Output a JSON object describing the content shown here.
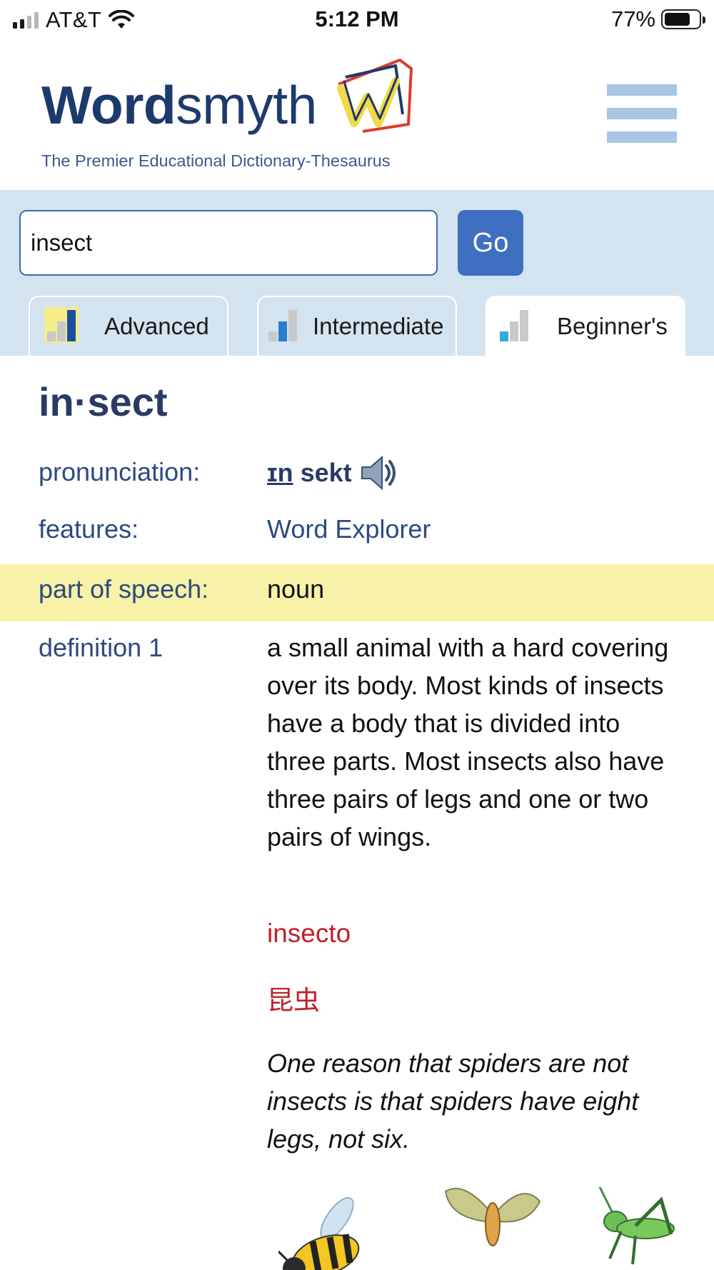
{
  "status_bar": {
    "carrier": "AT&T",
    "time": "5:12 PM",
    "battery_percent": "77%",
    "battery_level": 0.77
  },
  "header": {
    "logo_bold": "Word",
    "logo_light": "smyth",
    "tagline": "The Premier Educational Dictionary-Thesaurus",
    "menu_icon": "hamburger-menu-icon",
    "colors": {
      "logo_blue": "#1d3a6c",
      "menu": "#a8c5e2"
    }
  },
  "search": {
    "value": "insect",
    "go_label": "Go",
    "colors": {
      "band": "#d4e3f0",
      "button": "#3f6fc0"
    }
  },
  "tabs": [
    {
      "label": "Advanced",
      "icon": "level-advanced-icon",
      "active": false
    },
    {
      "label": "Intermediate",
      "icon": "level-intermediate-icon",
      "active": false
    },
    {
      "label": "Beginner's",
      "icon": "level-beginner-icon",
      "active": true
    }
  ],
  "entry": {
    "headword": "in·sect",
    "pronunciation_label": "pronunciation:",
    "pronunciation_stressed": "ɪn",
    "pronunciation_rest": "sekt",
    "audio_icon": "speaker-icon",
    "features_label": "features:",
    "features_value": "Word Explorer",
    "pos_label": "part of speech:",
    "pos_value": "noun",
    "definition_label": "definition 1",
    "definition_text": "a small animal with a hard covering over its body. Most kinds of insects have a body that is divided into three parts. Most insects also have three pairs of legs and one or two pairs of wings.",
    "translation_spanish": "insecto",
    "translation_japanese": "昆虫",
    "example": "One reason that spiders are not insects is that spiders have eight legs, not six.",
    "illustration_icons": [
      "bee-icon",
      "moth-icon",
      "grasshopper-icon"
    ],
    "colors": {
      "label_blue": "#2c4a80",
      "translation_red": "#c0202a",
      "highlight": "#f7f2a8"
    }
  }
}
